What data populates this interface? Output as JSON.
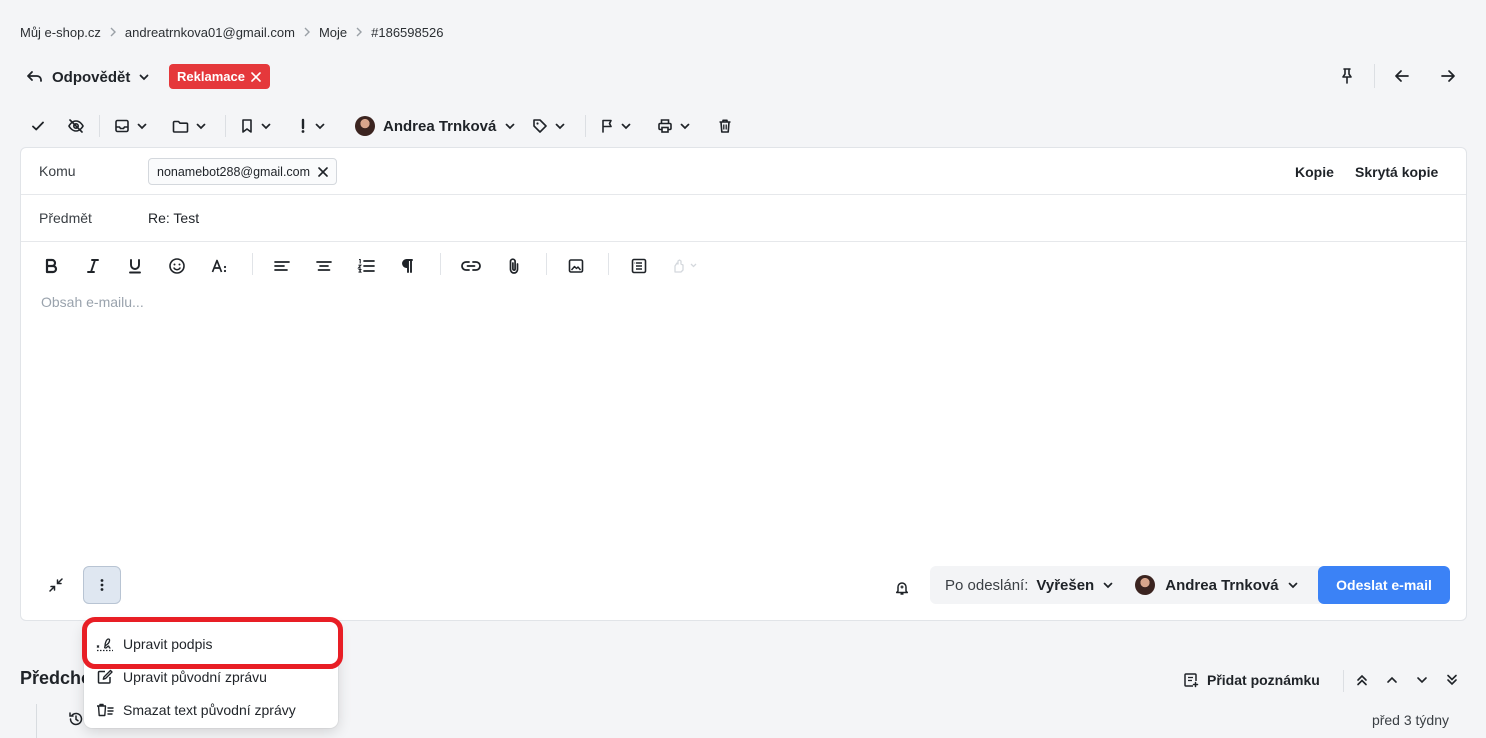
{
  "breadcrumb": [
    "Můj e-shop.cz",
    "andreatrnkova01@gmail.com",
    "Moje",
    "#186598526"
  ],
  "header": {
    "reply_label": "Odpovědět",
    "tag_label": "Reklamace",
    "tag_color": "#e5383b"
  },
  "toolbar": {
    "assignee": "Andrea Trnková"
  },
  "compose": {
    "to_label": "Komu",
    "to_chip": "nonamebot288@gmail.com",
    "cc_label": "Kopie",
    "bcc_label": "Skrytá kopie",
    "subject_label": "Předmět",
    "subject_value": "Re: Test",
    "body_placeholder": "Obsah e-mailu...",
    "after_send_label": "Po odeslání:",
    "after_send_status": "Vyřešen",
    "after_send_assignee": "Andrea Trnková",
    "send_label": "Odeslat e-mail",
    "send_color": "#3b82f6"
  },
  "history": {
    "title": "Předchozí",
    "add_note_label": "Přidat poznámku",
    "time": "před 3 týdny"
  },
  "menu": {
    "items": [
      "Upravit podpis",
      "Upravit původní zprávu",
      "Smazat text původní zprávy"
    ],
    "highlight_color": "#e81e25"
  }
}
